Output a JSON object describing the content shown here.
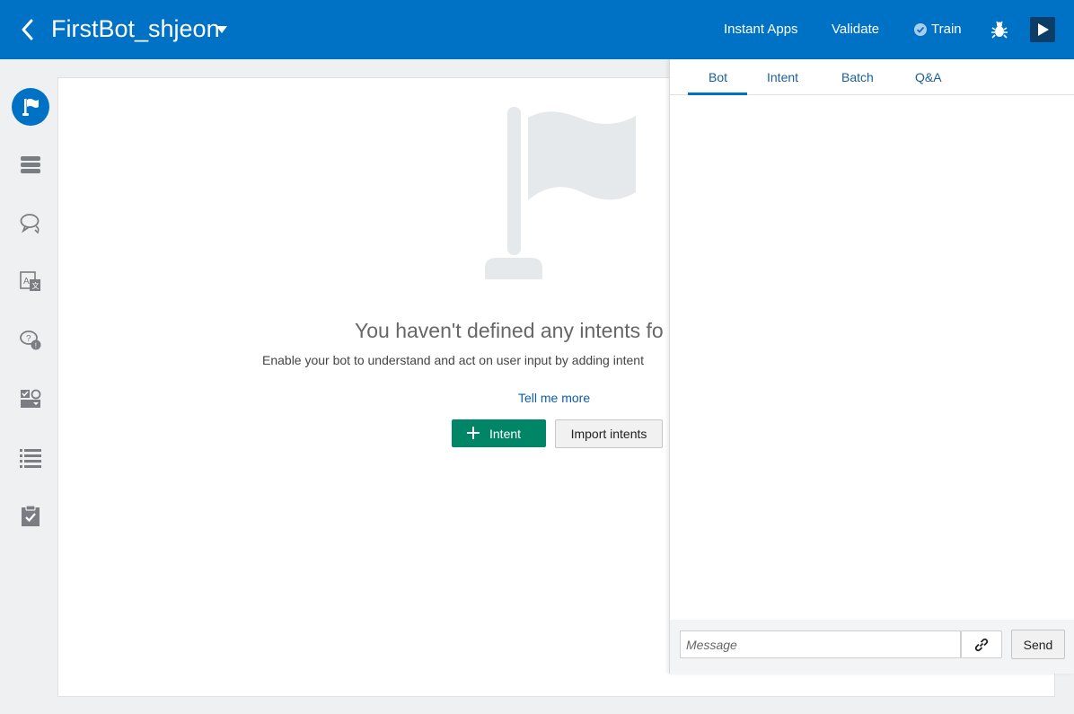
{
  "header": {
    "bot_name": "FirstBot_shjeon",
    "links": {
      "instant_apps": "Instant Apps",
      "validate": "Validate",
      "train": "Train"
    }
  },
  "sidebar": {
    "items": [
      {
        "icon": "intents-flag-icon",
        "active": true
      },
      {
        "icon": "entities-icon"
      },
      {
        "icon": "flows-chat-icon"
      },
      {
        "icon": "resource-bundles-icon"
      },
      {
        "icon": "qna-icon"
      },
      {
        "icon": "components-icon"
      },
      {
        "icon": "channels-list-icon"
      },
      {
        "icon": "clipboard-check-icon"
      }
    ]
  },
  "main": {
    "empty_heading": "You haven't defined any intents fo",
    "empty_description": "Enable your bot to understand and act on user input by adding intent",
    "tell_me_more": "Tell me more",
    "add_intent_label": "Intent",
    "import_intents_label": "Import intents"
  },
  "tester": {
    "tabs": [
      "Bot",
      "Intent",
      "Batch",
      "Q&A"
    ],
    "active_tab": "Bot",
    "message_placeholder": "Message",
    "send_label": "Send"
  },
  "colors": {
    "header_bg": "#0072c6",
    "primary_green": "#008566",
    "link_blue": "#0a5fa8"
  }
}
